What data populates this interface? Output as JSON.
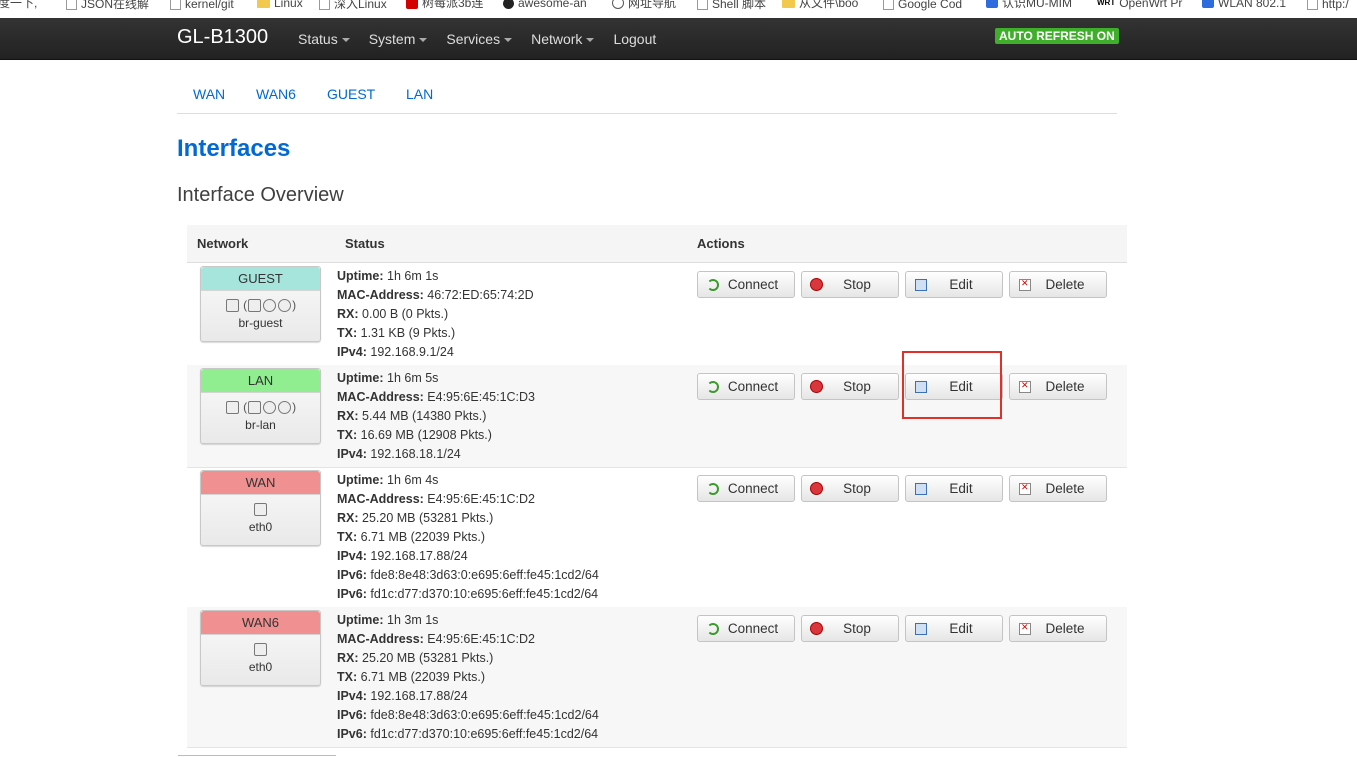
{
  "bookmarks": [
    {
      "label": "度一下,",
      "icon": "none"
    },
    {
      "label": "JSON在线解",
      "icon": "page-icon"
    },
    {
      "label": "kernel/git",
      "icon": "page-icon"
    },
    {
      "label": "Linux",
      "icon": "folder-icon"
    },
    {
      "label": "深入Linux",
      "icon": "page-icon"
    },
    {
      "label": "树莓派3b连",
      "icon": "red-c-icon"
    },
    {
      "label": "awesome-an",
      "icon": "github-icon"
    },
    {
      "label": "网址导航",
      "icon": "globe-icon"
    },
    {
      "label": "Shell 脚本",
      "icon": "page-icon"
    },
    {
      "label": "从文件\\boo",
      "icon": "folder-icon"
    },
    {
      "label": "Google Cod",
      "icon": "page-icon"
    },
    {
      "label": "认识MU-MIM",
      "icon": "blue-icon"
    },
    {
      "label": "OpenWrt Pr",
      "icon": "wrt-icon"
    },
    {
      "label": "WLAN 802.1",
      "icon": "blue-icon"
    },
    {
      "label": "http:/",
      "icon": "page-icon"
    }
  ],
  "navbar": {
    "brand": "GL-B1300",
    "menu": [
      "Status",
      "System",
      "Services",
      "Network",
      "Logout"
    ],
    "refresh": "AUTO REFRESH ON"
  },
  "tabs": [
    "WAN",
    "WAN6",
    "GUEST",
    "LAN"
  ],
  "page_title": "Interfaces",
  "section_title": "Interface Overview",
  "table": {
    "headers": {
      "network": "Network",
      "status": "Status",
      "actions": "Actions"
    },
    "buttons": {
      "connect": "Connect",
      "stop": "Stop",
      "edit": "Edit",
      "delete": "Delete"
    },
    "rows": [
      {
        "name": "GUEST",
        "color": "#a6e5db",
        "device": "br-guest",
        "icons": "bridge",
        "status": [
          {
            "k": "Uptime:",
            "v": "1h 6m 1s"
          },
          {
            "k": "MAC-Address:",
            "v": "46:72:ED:65:74:2D"
          },
          {
            "k": "RX:",
            "v": "0.00 B (0 Pkts.)"
          },
          {
            "k": "TX:",
            "v": "1.31 KB (9 Pkts.)"
          },
          {
            "k": "IPv4:",
            "v": "192.168.9.1/24"
          }
        ]
      },
      {
        "name": "LAN",
        "color": "#90ee90",
        "device": "br-lan",
        "icons": "bridge",
        "status": [
          {
            "k": "Uptime:",
            "v": "1h 6m 5s"
          },
          {
            "k": "MAC-Address:",
            "v": "E4:95:6E:45:1C:D3"
          },
          {
            "k": "RX:",
            "v": "5.44 MB (14380 Pkts.)"
          },
          {
            "k": "TX:",
            "v": "16.69 MB (12908 Pkts.)"
          },
          {
            "k": "IPv4:",
            "v": "192.168.18.1/24"
          }
        ]
      },
      {
        "name": "WAN",
        "color": "#f09090",
        "device": "eth0",
        "icons": "single",
        "status": [
          {
            "k": "Uptime:",
            "v": "1h 6m 4s"
          },
          {
            "k": "MAC-Address:",
            "v": "E4:95:6E:45:1C:D2"
          },
          {
            "k": "RX:",
            "v": "25.20 MB (53281 Pkts.)"
          },
          {
            "k": "TX:",
            "v": "6.71 MB (22039 Pkts.)"
          },
          {
            "k": "IPv4:",
            "v": "192.168.17.88/24"
          },
          {
            "k": "IPv6:",
            "v": "fde8:8e48:3d63:0:e695:6eff:fe45:1cd2/64"
          },
          {
            "k": "IPv6:",
            "v": "fd1c:d77:d370:10:e695:6eff:fe45:1cd2/64"
          }
        ]
      },
      {
        "name": "WAN6",
        "color": "#f09090",
        "device": "eth0",
        "icons": "single",
        "status": [
          {
            "k": "Uptime:",
            "v": "1h 3m 1s"
          },
          {
            "k": "MAC-Address:",
            "v": "E4:95:6E:45:1C:D2"
          },
          {
            "k": "RX:",
            "v": "25.20 MB (53281 Pkts.)"
          },
          {
            "k": "TX:",
            "v": "6.71 MB (22039 Pkts.)"
          },
          {
            "k": "IPv4:",
            "v": "192.168.17.88/24"
          },
          {
            "k": "IPv6:",
            "v": "fde8:8e48:3d63:0:e695:6eff:fe45:1cd2/64"
          },
          {
            "k": "IPv6:",
            "v": "fd1c:d77:d370:10:e695:6eff:fe45:1cd2/64"
          }
        ]
      }
    ]
  }
}
